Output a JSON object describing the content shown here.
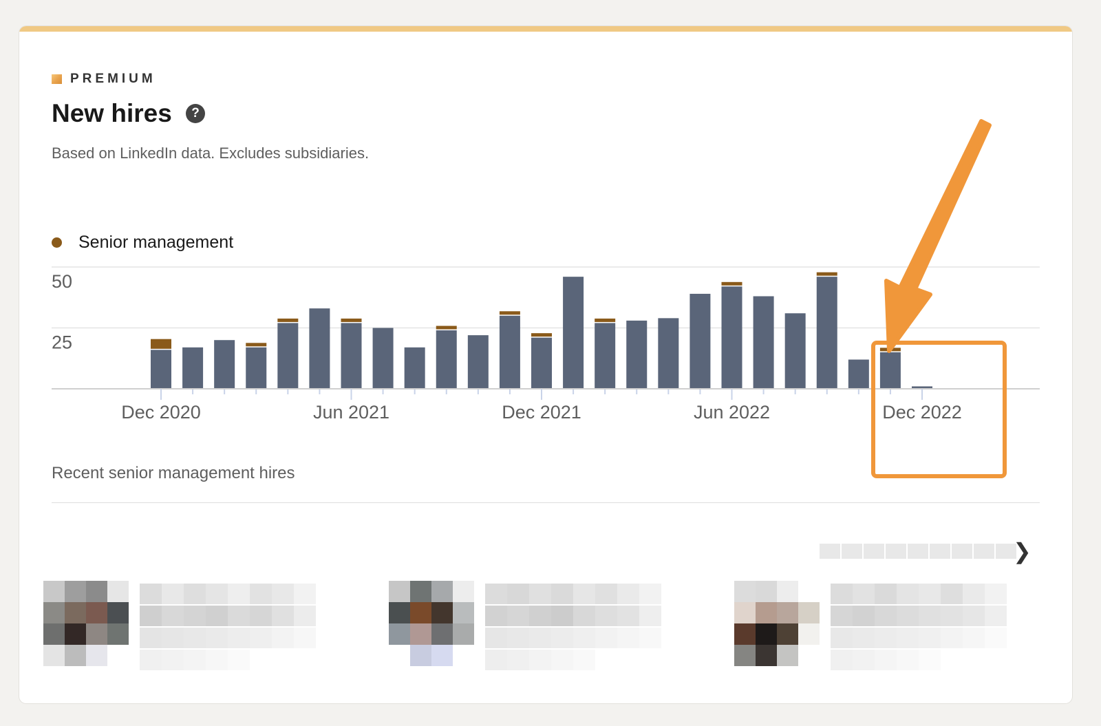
{
  "premium_label": "PREMIUM",
  "title": "New hires",
  "subtitle": "Based on LinkedIn data. Excludes subsidiaries.",
  "help_icon": "question-circle-icon",
  "legend": [
    {
      "name": "Senior management",
      "color": "#8a5a1a"
    }
  ],
  "colors": {
    "bar": "#5a6579",
    "senior": "#8a5a1a",
    "accent_border": "#f0c984",
    "annotation": "#f0973a"
  },
  "chart_data": {
    "type": "bar",
    "stacked": true,
    "x_ticks": [
      "Dec 2020",
      "Jun 2021",
      "Dec 2021",
      "Jun 2022",
      "Dec 2022"
    ],
    "y_ticks": [
      50,
      25
    ],
    "ylim": [
      0,
      50
    ],
    "grid": true,
    "categories": [
      "Dec 2020",
      "Jan 2021",
      "Feb 2021",
      "Mar 2021",
      "Apr 2021",
      "May 2021",
      "Jun 2021",
      "Jul 2021",
      "Aug 2021",
      "Sep 2021",
      "Oct 2021",
      "Nov 2021",
      "Dec 2021",
      "Jan 2022",
      "Feb 2022",
      "Mar 2022",
      "Apr 2022",
      "May 2022",
      "Jun 2022",
      "Jul 2022",
      "Aug 2022",
      "Sep 2022",
      "Oct 2022",
      "Nov 2022",
      "Dec 2022"
    ],
    "series": [
      {
        "name": "",
        "values": [
          16,
          17,
          20,
          17,
          27,
          33,
          27,
          25,
          17,
          24,
          22,
          30,
          21,
          46,
          27,
          28,
          29,
          39,
          42,
          38,
          31,
          46,
          12,
          15,
          1
        ]
      },
      {
        "name": "Senior management",
        "values": [
          4,
          0,
          0,
          1,
          1,
          0,
          1,
          0,
          0,
          1,
          0,
          1,
          1,
          0,
          1,
          0,
          0,
          0,
          1,
          0,
          0,
          1,
          0,
          1,
          0
        ]
      }
    ]
  },
  "recent_title": "Recent senior management hires",
  "carousel_next": "❯",
  "hires_blurred": [
    {
      "avatar": [
        "#c8c8c8",
        "#9e9e9e",
        "#8b8b8b",
        "#e6e6e6",
        "#8b8a86",
        "#7b6a5e",
        "#7b5a50",
        "#4b4f52",
        "#6e6f6e",
        "#332826",
        "#8e8783",
        "#6f7471",
        "#e4e4e4",
        "#bcbcbc",
        "#e6e6ec",
        "#ffffff"
      ],
      "lines": [
        [
          "#dcdcdc",
          "#e8e8e8",
          "#dedede",
          "#e5e5e5",
          "#eeeeee",
          "#e2e2e2",
          "#e8e8e8",
          "#f2f2f2"
        ],
        [
          "#cfcfcf",
          "#d8d8d8",
          "#d4d4d4",
          "#d0d0d0",
          "#dadada",
          "#d6d6d6",
          "#e0e0e0",
          "#ececec"
        ],
        [
          "#e4e4e4",
          "#e6e6e6",
          "#e8e8e8",
          "#eaeaea",
          "#ededed",
          "#efefef",
          "#f3f3f3",
          "#f7f7f7"
        ],
        [
          "#f0f0f0",
          "#f2f2f2",
          "#f4f4f4",
          "#f7f7f7",
          "#fafafa",
          "#ffffff",
          "#ffffff",
          "#ffffff"
        ]
      ]
    },
    {
      "avatar": [
        "#c6c6c6",
        "#6f7473",
        "#a6a9ab",
        "#ededed",
        "#4a4f50",
        "#7a4a2a",
        "#43362d",
        "#b9bcbd",
        "#8f979e",
        "#b09894",
        "#6e6f71",
        "#a9abab",
        "#ffffff",
        "#c8cce0",
        "#d6daf0",
        "#ffffff"
      ],
      "lines": [
        [
          "#dcdcdc",
          "#d8d8d8",
          "#e0e0e0",
          "#dadada",
          "#e6e6e6",
          "#e0e0e0",
          "#eaeaea",
          "#f2f2f2"
        ],
        [
          "#d2d2d2",
          "#d6d6d6",
          "#d0d0d0",
          "#cccccc",
          "#d8d8d8",
          "#dedede",
          "#e2e2e2",
          "#eeeeee"
        ],
        [
          "#e6e6e6",
          "#e8e8e8",
          "#eaeaea",
          "#ececec",
          "#efefef",
          "#f2f2f2",
          "#f5f5f5",
          "#f8f8f8"
        ],
        [
          "#eeeeee",
          "#f0f0f0",
          "#f3f3f3",
          "#f6f6f6",
          "#f9f9f9",
          "#ffffff",
          "#ffffff",
          "#ffffff"
        ]
      ]
    },
    {
      "avatar": [
        "#dcdcdc",
        "#d9d9d9",
        "#ededed",
        "#ffffff",
        "#e0d4cc",
        "#b59c8f",
        "#b8a69c",
        "#d6d0c6",
        "#5a3a2c",
        "#1e1a19",
        "#4e4135",
        "#f2f1ee",
        "#858582",
        "#3b3532",
        "#c4c4c2",
        "#ffffff"
      ],
      "lines": [
        [
          "#dcdcdc",
          "#e2e2e2",
          "#dadada",
          "#e4e4e4",
          "#e8e8e8",
          "#dedede",
          "#eaeaea",
          "#f2f2f2"
        ],
        [
          "#d6d6d6",
          "#d2d2d2",
          "#d8d8d8",
          "#dcdcdc",
          "#e0e0e0",
          "#e2e2e2",
          "#e6e6e6",
          "#eeeeee"
        ],
        [
          "#e8e8e8",
          "#eaeaea",
          "#ececec",
          "#eeeeee",
          "#f0f0f0",
          "#f3f3f3",
          "#f6f6f6",
          "#fafafa"
        ],
        [
          "#f0f0f0",
          "#f2f2f2",
          "#f5f5f5",
          "#f8f8f8",
          "#fbfbfb",
          "#ffffff",
          "#ffffff",
          "#ffffff"
        ]
      ]
    }
  ]
}
